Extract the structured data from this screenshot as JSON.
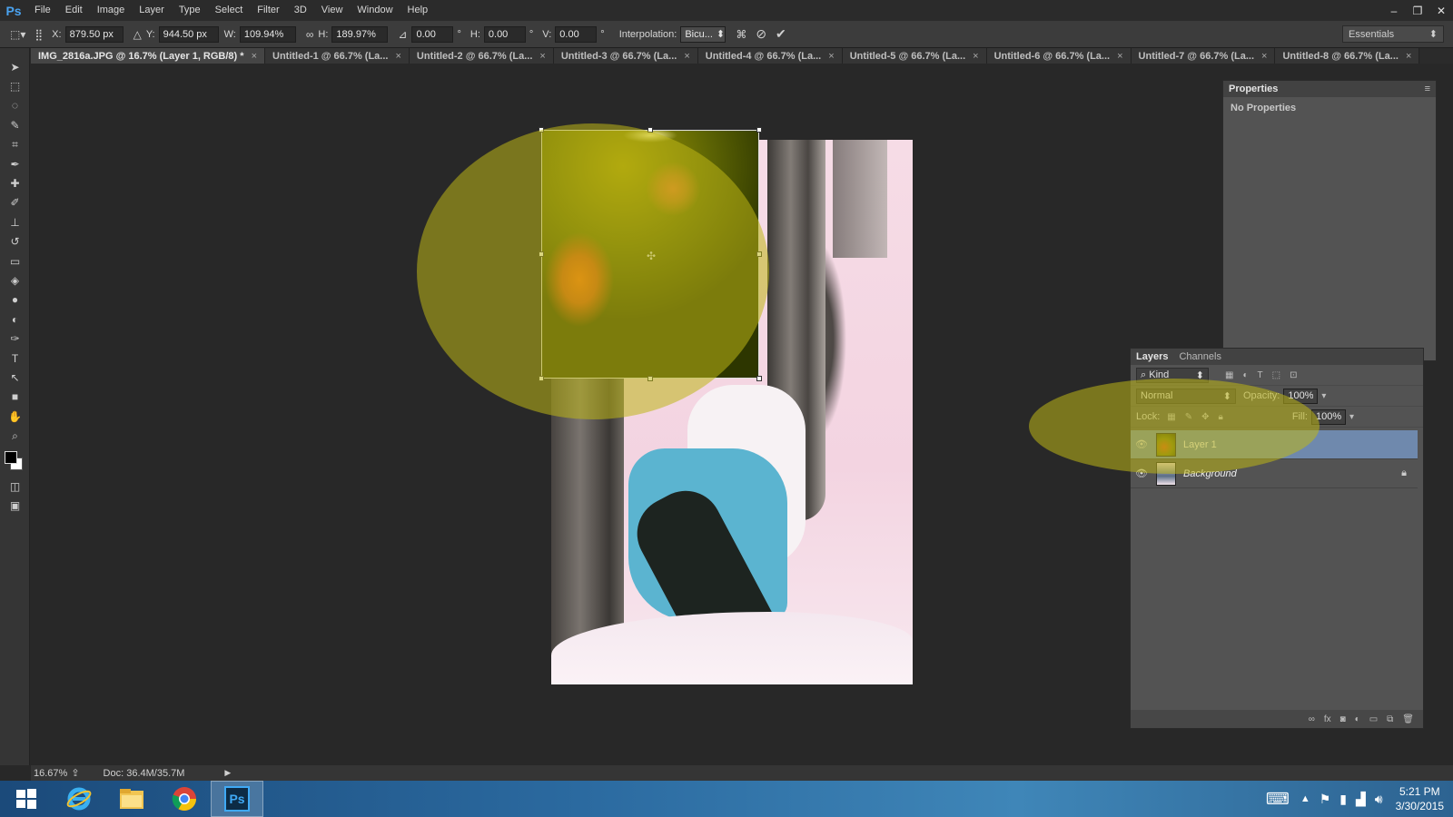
{
  "app": {
    "logo": "Ps"
  },
  "menu": [
    "File",
    "Edit",
    "Image",
    "Layer",
    "Type",
    "Select",
    "Filter",
    "3D",
    "View",
    "Window",
    "Help"
  ],
  "window_controls": [
    "–",
    "❐",
    "✕"
  ],
  "options": {
    "x_label": "X:",
    "x_value": "879.50 px",
    "y_label": "Y:",
    "y_value": "944.50 px",
    "w_label": "W:",
    "w_value": "109.94%",
    "h_label": "H:",
    "h_value": "189.97%",
    "angle_value": "0.00",
    "deg": "°",
    "hskew_label": "H:",
    "hskew_value": "0.00",
    "vskew_label": "V:",
    "vskew_value": "0.00",
    "interp_label": "Interpolation:",
    "interp_value": "Bicu...",
    "workspace": "Essentials"
  },
  "tabs": [
    {
      "label": "IMG_2816a.JPG @ 16.7% (Layer 1, RGB/8) *",
      "active": true
    },
    {
      "label": "Untitled-1 @ 66.7% (La...",
      "active": false
    },
    {
      "label": "Untitled-2 @ 66.7% (La...",
      "active": false
    },
    {
      "label": "Untitled-3 @ 66.7% (La...",
      "active": false
    },
    {
      "label": "Untitled-4 @ 66.7% (La...",
      "active": false
    },
    {
      "label": "Untitled-5 @ 66.7% (La...",
      "active": false
    },
    {
      "label": "Untitled-6 @ 66.7% (La...",
      "active": false
    },
    {
      "label": "Untitled-7 @ 66.7% (La...",
      "active": false
    },
    {
      "label": "Untitled-8 @ 66.7% (La...",
      "active": false
    }
  ],
  "tools": [
    "move-tool-icon",
    "marquee-tool-icon",
    "lasso-tool-icon",
    "quick-select-icon",
    "crop-tool-icon",
    "eyedropper-icon",
    "healing-brush-icon",
    "brush-tool-icon",
    "clone-stamp-icon",
    "history-brush-icon",
    "eraser-icon",
    "paint-bucket-icon",
    "blur-tool-icon",
    "dodge-tool-icon",
    "pen-tool-icon",
    "type-tool-icon",
    "path-select-icon",
    "shape-tool-icon",
    "hand-tool-icon",
    "zoom-tool-icon"
  ],
  "tool_glyphs": [
    "➤",
    "⬚",
    "◌",
    "✎",
    "⌗",
    "✒",
    "✚",
    "✐",
    "⊥",
    "↺",
    "▭",
    "◈",
    "●",
    "◐",
    "✑",
    "T",
    "↖",
    "■",
    "✋",
    "⌕"
  ],
  "status": {
    "zoom": "16.67%",
    "doc": "Doc: 36.4M/35.7M"
  },
  "properties": {
    "title": "Properties",
    "body": "No Properties"
  },
  "layers_panel": {
    "tabs": [
      "Layers",
      "Channels"
    ],
    "kind": "Kind",
    "blend_mode": "Normal",
    "opacity_label": "Opacity:",
    "opacity_value": "100%",
    "lock_label": "Lock:",
    "fill_label": "Fill:",
    "fill_value": "100%",
    "layers": [
      {
        "name": "Layer 1",
        "selected": true,
        "locked": false
      },
      {
        "name": "Background",
        "selected": false,
        "locked": true
      }
    ]
  },
  "clock": {
    "time": "5:21 PM",
    "date": "3/30/2015"
  },
  "colors": {
    "accent": "#6f89ad",
    "highlight": "#bdb616"
  }
}
